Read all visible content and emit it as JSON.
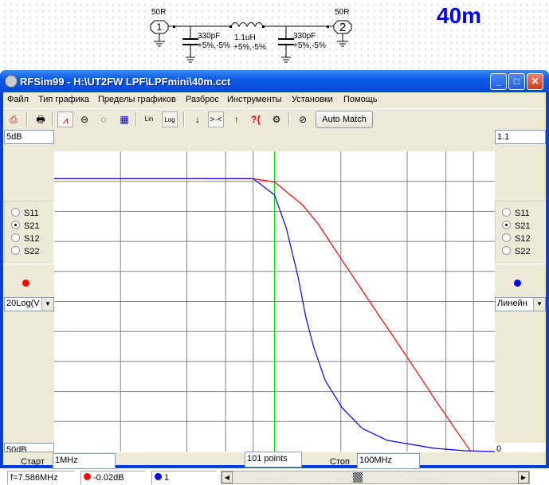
{
  "schematic": {
    "port1": {
      "num": "1",
      "imp": "50R"
    },
    "port2": {
      "num": "2",
      "imp": "50R"
    },
    "c1": {
      "value": "330pF",
      "tol": "+5%,-5%"
    },
    "l1": {
      "value": "1.1uH",
      "tol": "+5%,-5%"
    },
    "c2": {
      "value": "330pF",
      "tol": "+5%,-5%"
    },
    "band_label": "40m"
  },
  "window": {
    "title": "RFSim99 - H:\\UT2FW LPF\\LPFmini\\40m.cct",
    "min": "_",
    "max": "□",
    "close": "✕"
  },
  "menu": [
    "Файл",
    "Тип графика",
    "Пределы графиков",
    "Разброс",
    "Инструменты",
    "Установки",
    "Помощь"
  ],
  "toolbar": {
    "icons": [
      "save-icon",
      "print-icon",
      "graph-icon",
      "smith-chart-icon",
      "polar-icon",
      "table-icon",
      "lin-icon",
      "log-icon",
      "arrow-down-icon",
      "zoom-fit-icon",
      "arrow-up-icon",
      "help-icon",
      "component-icon",
      "tune-icon"
    ],
    "lin": "Lin",
    "log": "Log",
    "auto_match": "Auto Match"
  },
  "left": {
    "top": "5dB",
    "bottom": "50dB",
    "radios": [
      "S11",
      "S21",
      "S12",
      "S22"
    ],
    "selected": "S21",
    "dot_color": "#ff0000",
    "scale": "20Log(V"
  },
  "right": {
    "top": "1.1",
    "bottom": "0",
    "radios": [
      "S11",
      "S21",
      "S12",
      "S22"
    ],
    "selected": "S21",
    "dot_color": "#0000ff",
    "scale": "Линейн"
  },
  "sweep": {
    "start_label": "Старт",
    "start": "1MHz",
    "points": "101 points",
    "stop_label": "Стоп",
    "stop": "100MHz"
  },
  "status": {
    "freq": "f=7.586MHz",
    "red_val": "-0.02dB",
    "blue_val": "1"
  },
  "chart_data": {
    "type": "line",
    "xscale": "log",
    "xlim": [
      1,
      100
    ],
    "xunit": "MHz",
    "xgrid": [
      2,
      4,
      6,
      8,
      10,
      20,
      40,
      60,
      80
    ],
    "marker_x": 10,
    "series": [
      {
        "name": "S21 dB (left axis)",
        "color": "#ff0000",
        "axis": "left",
        "ylim": [
          -50,
          5
        ],
        "x": [
          1,
          2,
          4,
          8,
          10,
          13.4,
          15.9,
          20.3,
          28.4,
          39.8,
          55.5,
          77.5
        ],
        "y": [
          0,
          0,
          0,
          -0.02,
          -0.6,
          -4.8,
          -8.5,
          -15,
          -23.8,
          -32.6,
          -41.4,
          -49.9
        ]
      },
      {
        "name": "S21 linear (right axis)",
        "color": "#0000ff",
        "axis": "right",
        "ylim": [
          0,
          1.1
        ],
        "x": [
          1,
          2,
          4,
          8,
          10,
          11.3,
          12.8,
          13.9,
          15.1,
          17,
          20.3,
          25,
          32.5,
          53,
          73,
          100
        ],
        "y": [
          1,
          1,
          1,
          1,
          0.94,
          0.82,
          0.64,
          0.49,
          0.38,
          0.26,
          0.16,
          0.085,
          0.041,
          0.012,
          0.003,
          0
        ]
      }
    ]
  }
}
